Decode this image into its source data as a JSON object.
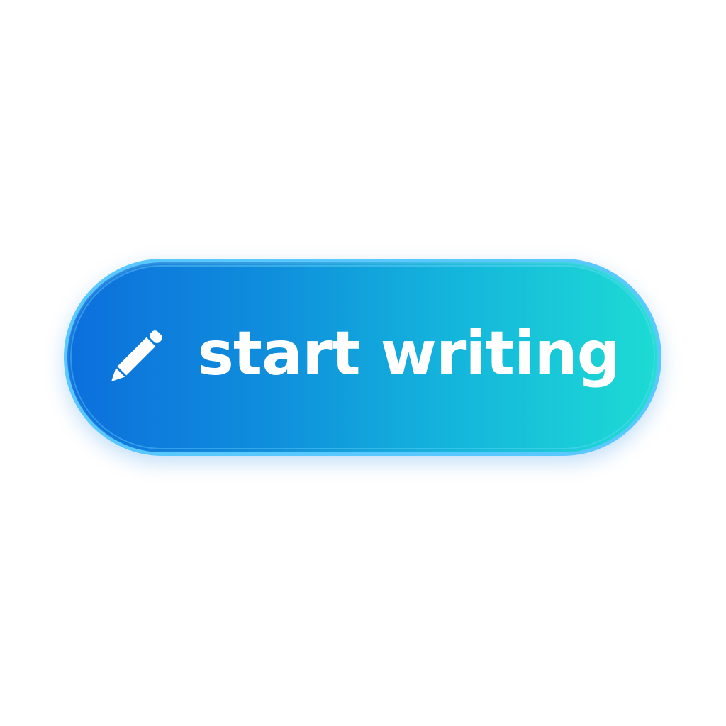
{
  "button": {
    "label": "start writing",
    "icon": "pencil-icon"
  },
  "colors": {
    "gradient_start": "#0c6fdc",
    "gradient_end": "#1ddbd4",
    "border": "#58c8ff",
    "text": "#ffffff"
  }
}
